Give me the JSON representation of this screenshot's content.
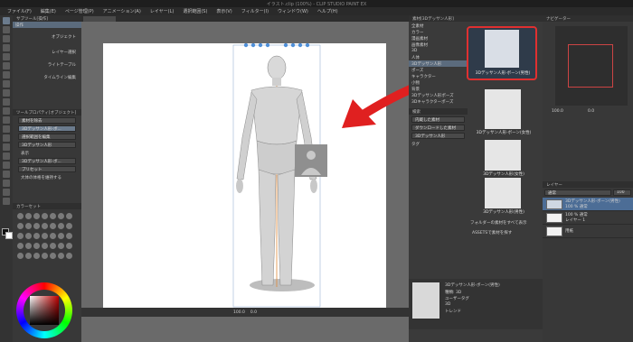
{
  "window": {
    "title": "イラスト.clip (100%) - CLIP STUDIO PAINT EX"
  },
  "menu": [
    "ファイル(F)",
    "編集(E)",
    "ページ管理(P)",
    "アニメーション(A)",
    "レイヤー(L)",
    "選択範囲(S)",
    "表示(V)",
    "フィルター(I)",
    "ウィンドウ(W)",
    "ヘルプ(H)"
  ],
  "tool_property": {
    "header": "サブツール[操作]",
    "tool_name": "操作",
    "rows": [
      "オブジェクト",
      "レイヤー選択",
      "ライトテーブル",
      "タイムライン編集"
    ]
  },
  "tool_options": {
    "header": "ツールプロパティ[オブジェクト]",
    "rows": [
      "素材を除去",
      "選択範囲を編集",
      "3Dデッサン人形",
      "表示",
      "プリセット"
    ],
    "selected": "3Dデッサン人形-ボ...",
    "item_label": "3Dデッサン人形-ボ...",
    "check_label": "大体の体格を維持する"
  },
  "palette": {
    "header": "カラーセット"
  },
  "material": {
    "header": "素材[3Dデッサン人形]",
    "tree": [
      "全素材",
      "カラー",
      "漫画素材",
      "画像素材",
      "3D",
      "人体",
      "3Dデッサン人形",
      "ポーズ",
      "キャラクター",
      "小物",
      "背景",
      "3Dデッサン人形ポーズ",
      "3Dキャラクターポーズ"
    ],
    "selected_index": 6,
    "items": [
      {
        "caption": "3Dデッサン人形-ボーン(男性)",
        "selected": true
      },
      {
        "caption": "3Dデッサン人形-ボーン(女性)",
        "selected": false
      },
      {
        "caption": "3Dデッサン人形(女性)",
        "selected": false
      },
      {
        "caption": "3Dデッサン人形(男性)",
        "selected": false
      }
    ],
    "search_label": "検索",
    "tag_buttons": [
      "内蔵した素材",
      "ダウンロードした素材",
      "3Dデッサン人形"
    ],
    "subheader": "タグ",
    "footer_note": "フォルダーの素材をすべて表示",
    "asset_check": "ASSETSで素材を探す",
    "detail": {
      "name": "3Dデッサン人形-ボーン(男性)",
      "kind": "種類: 3D",
      "user": "ユーザータグ",
      "count": "3D",
      "extra": "トレンド"
    }
  },
  "layers": {
    "header": "レイヤー",
    "mode": "通常",
    "opacity": "100",
    "rows": [
      {
        "name": "3Dデッサン人形-ボーン(男性)",
        "sub": "100 % 通常"
      },
      {
        "name": "100 % 通常",
        "sub": "レイヤー 1"
      },
      {
        "name": "用紙",
        "sub": ""
      }
    ]
  },
  "navigator": {
    "header": "ナビゲーター",
    "zoom": "100.0",
    "rotate": "0.0"
  },
  "canvas_bottom": {
    "zoom": "100.0",
    "angle": "0.0"
  },
  "colors": {
    "accent": "#5b6b7d",
    "arrow": "#e02020",
    "highlight": "#e03030"
  }
}
